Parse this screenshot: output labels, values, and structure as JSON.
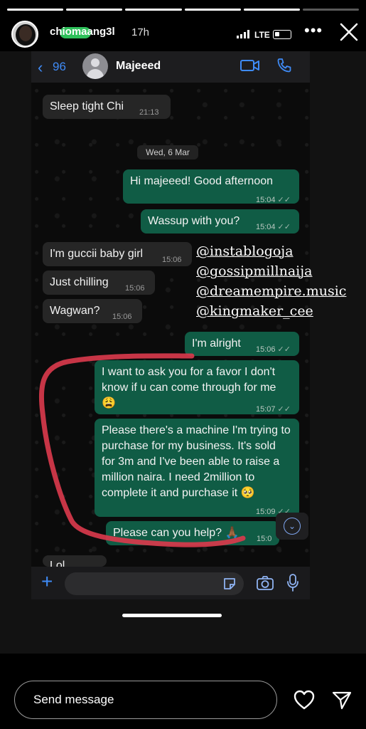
{
  "story": {
    "username": "chiomaang3l",
    "time_ago": "17h",
    "more_icon": "more-dots-icon",
    "close_icon": "close-icon",
    "progress_segments": 6,
    "progress_done": 5
  },
  "status_bar": {
    "network": "LTE"
  },
  "chat": {
    "back_count": "96",
    "contact_name": "Majeeed",
    "date_separator": "Wed, 6 Mar",
    "messages": [
      {
        "dir": "in",
        "text": "Sleep tight Chi",
        "time": "21:13"
      },
      {
        "dir": "out",
        "text": "Hi majeeed! Good afternoon",
        "time": "15:04"
      },
      {
        "dir": "out",
        "text": "Wassup with you?",
        "time": "15:04"
      },
      {
        "dir": "in",
        "text": "I'm guccii baby girl",
        "time": "15:06"
      },
      {
        "dir": "in",
        "text": "Just chilling",
        "time": "15:06"
      },
      {
        "dir": "in",
        "text": "Wagwan?",
        "time": "15:06"
      },
      {
        "dir": "out",
        "text": "I'm alright",
        "time": "15:06"
      },
      {
        "dir": "out",
        "text": "I want to ask you for a favor I don't know if u can come through for me 😩",
        "time": "15:07"
      },
      {
        "dir": "out",
        "text": "Please there's a machine I'm trying to purchase for my business. It's sold for 3m and I've been able to raise a million naira. I need 2million to complete it and purchase it 🥺",
        "time": "15:09"
      },
      {
        "dir": "out",
        "text": "Please can you help? 🙏🏾",
        "time": "15:0"
      },
      {
        "dir": "in",
        "text": "Lol",
        "time": ""
      }
    ]
  },
  "tags": [
    "@instablogoja",
    "@gossipmillnaija",
    "@dreamempire.music",
    "@kingmaker_cee"
  ],
  "reply": {
    "placeholder": "Send message"
  },
  "colors": {
    "outgoing_bubble": "#105c45",
    "incoming_bubble": "#262626",
    "accent_blue": "#3f8bf6",
    "annotation_red": "#d8394c"
  }
}
